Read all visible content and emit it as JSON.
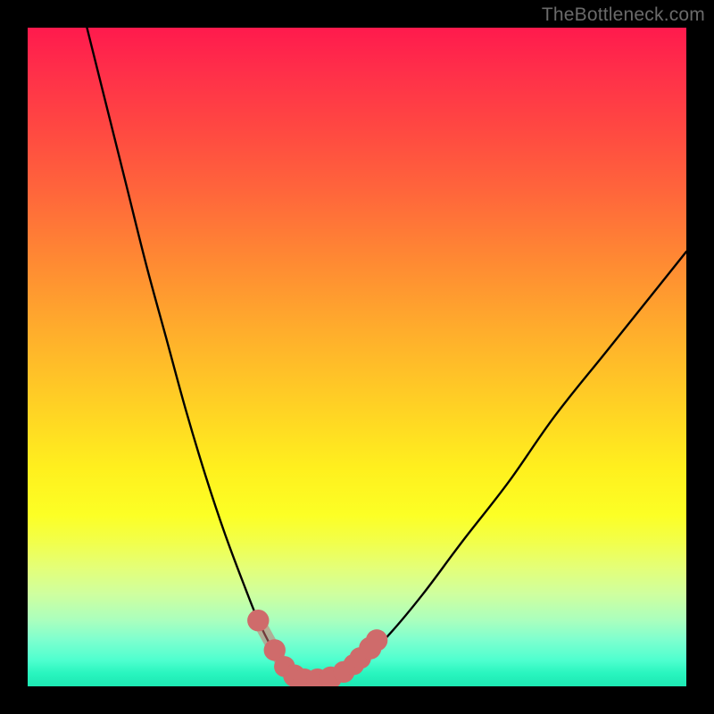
{
  "watermark": "TheBottleneck.com",
  "colors": {
    "frame": "#000000",
    "curve_stroke": "#000000",
    "marker_fill": "#cf6b6b",
    "marker_fill_alt": "#d07070",
    "gradient_top": "#ff1a4d",
    "gradient_bottom": "#1de8b3"
  },
  "chart_data": {
    "type": "line",
    "title": "",
    "xlabel": "",
    "ylabel": "",
    "xlim": [
      0,
      100
    ],
    "ylim": [
      0,
      100
    ],
    "grid": false,
    "legend": false,
    "series": [
      {
        "name": "bottleneck-curve",
        "x": [
          9,
          12,
          15,
          18,
          21,
          24,
          27,
          30,
          33,
          35,
          37,
          39,
          40.5,
          42,
          44,
          46,
          48,
          51,
          55,
          60,
          66,
          73,
          80,
          88,
          96,
          100
        ],
        "y": [
          100,
          88,
          76,
          64,
          53,
          42,
          32,
          23,
          15,
          10,
          6,
          3,
          1.5,
          1,
          1,
          1.2,
          2,
          4,
          8,
          14,
          22,
          31,
          41,
          51,
          61,
          66
        ]
      }
    ],
    "markers": [
      {
        "x": 35.0,
        "y": 10.0,
        "r": 1.4
      },
      {
        "x": 37.5,
        "y": 5.5,
        "r": 1.4
      },
      {
        "x": 39.0,
        "y": 3.0,
        "r": 1.3
      },
      {
        "x": 40.5,
        "y": 1.6,
        "r": 1.5
      },
      {
        "x": 42.0,
        "y": 1.0,
        "r": 1.5
      },
      {
        "x": 44.0,
        "y": 1.0,
        "r": 1.5
      },
      {
        "x": 46.0,
        "y": 1.3,
        "r": 1.5
      },
      {
        "x": 48.0,
        "y": 2.2,
        "r": 1.4
      },
      {
        "x": 49.5,
        "y": 3.3,
        "r": 1.3
      },
      {
        "x": 50.5,
        "y": 4.3,
        "r": 1.4
      },
      {
        "x": 52.0,
        "y": 5.8,
        "r": 1.5
      },
      {
        "x": 53.0,
        "y": 7.0,
        "r": 1.4
      }
    ],
    "annotations": []
  }
}
